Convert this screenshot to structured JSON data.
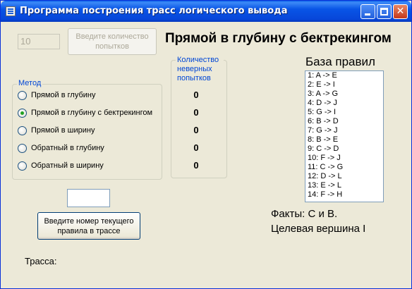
{
  "window": {
    "title": "Программа построения трасс логического вывода",
    "minimize_label": "",
    "close_label": "✕"
  },
  "attempts_input": {
    "value": "10"
  },
  "attempts_button": {
    "label": "Введите количество попытков"
  },
  "current_method_title": "Прямой в глубину с бектрекингом",
  "method_group": {
    "label": "Метод",
    "options": [
      {
        "label": "Прямой в глубину",
        "checked": false
      },
      {
        "label": "Прямой в глубину с бектрекингом",
        "checked": true
      },
      {
        "label": "Прямой в ширину",
        "checked": false
      },
      {
        "label": "Обратный в глубину",
        "checked": false
      },
      {
        "label": "Обратный в ширину",
        "checked": false
      }
    ]
  },
  "wrong_attempts_group": {
    "label": "Количество неверных попытков",
    "counts": [
      "0",
      "0",
      "0",
      "0",
      "0"
    ]
  },
  "rules": {
    "title": "База правил",
    "items": [
      "1: A -> E",
      "2: E -> I",
      "3: A -> G",
      "4: D -> J",
      "5: G -> I",
      "6: B -> D",
      "7: G -> J",
      "8: B -> E",
      "9: C -> D",
      "10: F -> J",
      "11: C -> G",
      "12: D -> L",
      "13: E -> L",
      "14: F -> H"
    ]
  },
  "rule_number_input": {
    "value": ""
  },
  "rule_number_button": {
    "label": "Введите номер текущего правила в трассе"
  },
  "facts_text": "Факты: C и B.",
  "goal_text": "Целевая вершина I",
  "trace_label": "Трасса:",
  "trace_value": ""
}
